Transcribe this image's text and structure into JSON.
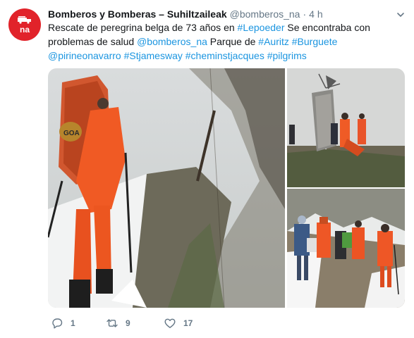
{
  "tweet": {
    "display_name": "Bomberos y Bomberas – Suhiltzaileak",
    "handle": "@bomberos_na",
    "separator": "·",
    "time": "4 h",
    "avatar_text": "na",
    "text_parts": [
      {
        "t": "Rescate de peregrina belga de 73 años en ",
        "link": false
      },
      {
        "t": "#Lepoeder",
        "link": true
      },
      {
        "t": " Se encontraba con problemas de salud ",
        "link": false
      },
      {
        "t": "@bomberos_na",
        "link": true
      },
      {
        "t": " Parque de ",
        "link": false
      },
      {
        "t": "#Auritz",
        "link": true
      },
      {
        "t": " ",
        "link": false
      },
      {
        "t": "#Burguete",
        "link": true
      },
      {
        "t": " ",
        "link": false
      },
      {
        "t": "@pirineonavarro",
        "link": true
      },
      {
        "t": " ",
        "link": false
      },
      {
        "t": "#Stjamesway",
        "link": true
      },
      {
        "t": " ",
        "link": false
      },
      {
        "t": "#cheminstjacques",
        "link": true
      },
      {
        "t": " ",
        "link": false
      },
      {
        "t": "#pilgrims",
        "link": true
      }
    ],
    "actions": {
      "reply_count": "1",
      "retweet_count": "9",
      "like_count": "17"
    },
    "media": [
      {
        "icon": "photo-rescuer-with-backpack"
      },
      {
        "icon": "photo-rescue-team-by-windmill"
      },
      {
        "icon": "photo-group-walking-trail"
      }
    ]
  },
  "colors": {
    "link": "#1b95e0",
    "muted": "#657786",
    "brand": "#e1232a",
    "text": "#14171a"
  }
}
